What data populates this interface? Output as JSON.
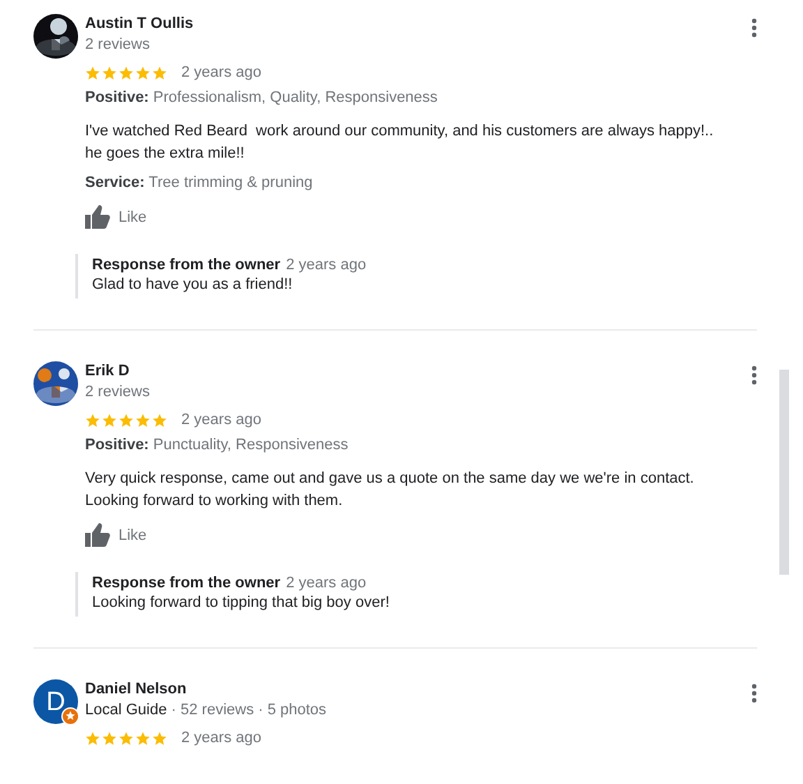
{
  "reviews": [
    {
      "name": "Austin T Oullis",
      "meta": "2 reviews",
      "stars": 5,
      "time": "2 years ago",
      "positive_label": "Positive:",
      "positive": "Professionalism, Quality, Responsiveness",
      "text": "I've watched Red Beard  work around our community, and his customers are always happy!.. he goes the extra mile!!",
      "service_label": "Service:",
      "service": "Tree trimming & pruning",
      "like": "Like",
      "response": {
        "label": "Response from the owner",
        "time": "2 years ago",
        "text": "Glad to have you as a friend!!"
      }
    },
    {
      "name": "Erik D",
      "meta": "2 reviews",
      "stars": 5,
      "time": "2 years ago",
      "positive_label": "Positive:",
      "positive": "Punctuality, Responsiveness",
      "text": "Very quick response, came out and gave us a quote on the same day we we're in contact.  Looking forward to working with them.",
      "like": "Like",
      "response": {
        "label": "Response from the owner",
        "time": "2 years ago",
        "text": "Looking forward to tipping that big boy over!"
      }
    },
    {
      "name": "Daniel Nelson",
      "avatar": {
        "kind": "letter",
        "letter": "D",
        "color": "#0b57a5",
        "local_guide": true
      },
      "meta_lead": "Local Guide",
      "meta": " · 52 reviews · 5 photos",
      "stars": 5,
      "time": "2 years ago"
    }
  ]
}
